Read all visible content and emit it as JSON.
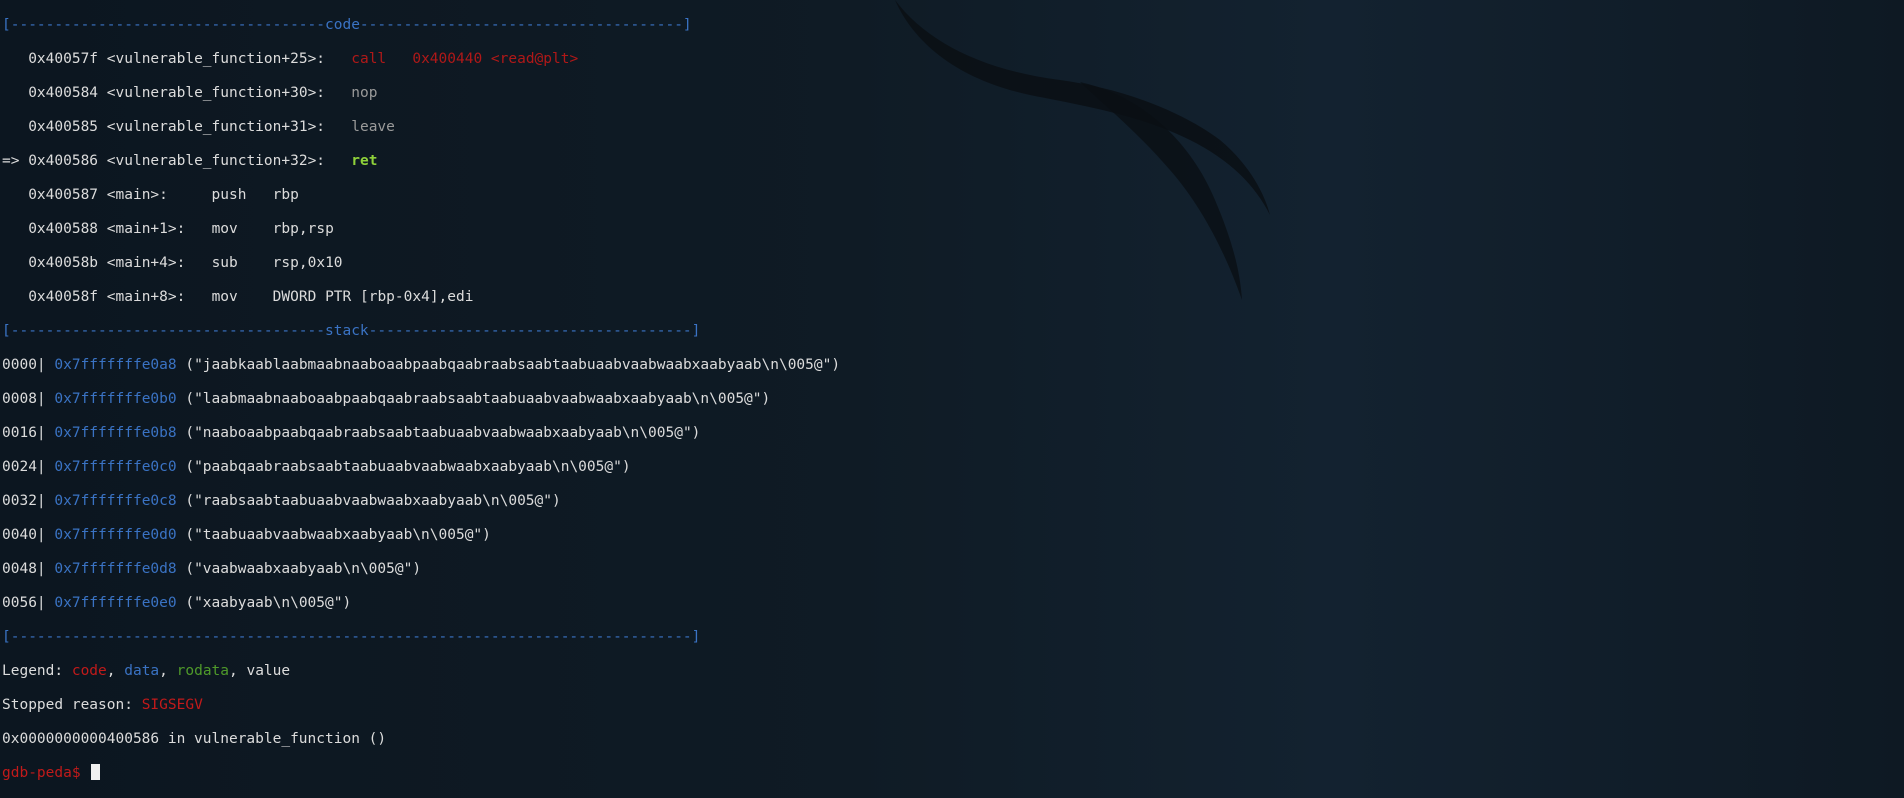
{
  "separators": {
    "code": "[------------------------------------code-------------------------------------]",
    "stack": "[------------------------------------stack-------------------------------------]",
    "end": "[------------------------------------------------------------------------------]"
  },
  "code_lines": [
    {
      "marker": "   ",
      "addr": "0x40057f",
      "sym": "<vulnerable_function+25>:",
      "pad": "   ",
      "op": "call",
      "args": "   0x400440 <read@plt>",
      "kind": "call"
    },
    {
      "marker": "   ",
      "addr": "0x400584",
      "sym": "<vulnerable_function+30>:",
      "pad": "   ",
      "op": "nop",
      "args": "",
      "kind": "dim"
    },
    {
      "marker": "   ",
      "addr": "0x400585",
      "sym": "<vulnerable_function+31>:",
      "pad": "   ",
      "op": "leave",
      "args": "",
      "kind": "dim"
    },
    {
      "marker": "=> ",
      "addr": "0x400586",
      "sym": "<vulnerable_function+32>:",
      "pad": "   ",
      "op": "ret",
      "args": "",
      "kind": "ret"
    },
    {
      "marker": "   ",
      "addr": "0x400587",
      "sym": "<main>:",
      "pad": "     ",
      "op": "push",
      "args": "   rbp",
      "kind": "norm"
    },
    {
      "marker": "   ",
      "addr": "0x400588",
      "sym": "<main+1>:",
      "pad": "   ",
      "op": "mov",
      "args": "    rbp,rsp",
      "kind": "norm"
    },
    {
      "marker": "   ",
      "addr": "0x40058b",
      "sym": "<main+4>:",
      "pad": "   ",
      "op": "sub",
      "args": "    rsp,0x10",
      "kind": "norm"
    },
    {
      "marker": "   ",
      "addr": "0x40058f",
      "sym": "<main+8>:",
      "pad": "   ",
      "op": "mov",
      "args": "    DWORD PTR [rbp-0x4],edi",
      "kind": "norm"
    }
  ],
  "stack_lines": [
    {
      "offset": "0000|",
      "ptr": "0x7fffffffe0a8",
      "value": "(\"jaabkaablaabmaabnaaboaabpaabqaabraabsaabtaabuaabvaabwaabxaabyaab\\n\\005@\")"
    },
    {
      "offset": "0008|",
      "ptr": "0x7fffffffe0b0",
      "value": "(\"laabmaabnaaboaabpaabqaabraabsaabtaabuaabvaabwaabxaabyaab\\n\\005@\")"
    },
    {
      "offset": "0016|",
      "ptr": "0x7fffffffe0b8",
      "value": "(\"naaboaabpaabqaabraabsaabtaabuaabvaabwaabxaabyaab\\n\\005@\")"
    },
    {
      "offset": "0024|",
      "ptr": "0x7fffffffe0c0",
      "value": "(\"paabqaabraabsaabtaabuaabvaabwaabxaabyaab\\n\\005@\")"
    },
    {
      "offset": "0032|",
      "ptr": "0x7fffffffe0c8",
      "value": "(\"raabsaabtaabuaabvaabwaabxaabyaab\\n\\005@\")"
    },
    {
      "offset": "0040|",
      "ptr": "0x7fffffffe0d0",
      "value": "(\"taabuaabvaabwaabxaabyaab\\n\\005@\")"
    },
    {
      "offset": "0048|",
      "ptr": "0x7fffffffe0d8",
      "value": "(\"vaabwaabxaabyaab\\n\\005@\")"
    },
    {
      "offset": "0056|",
      "ptr": "0x7fffffffe0e0",
      "value": "(\"xaabyaab\\n\\005@\")"
    }
  ],
  "legend": {
    "prefix": "Legend: ",
    "code": "code",
    "comma1": ", ",
    "data": "data",
    "comma2": ", ",
    "rodata": "rodata",
    "rest": ", value"
  },
  "stopped": {
    "prefix": "Stopped reason: ",
    "reason": "SIGSEGV"
  },
  "location_line": "0x0000000000400586 in vulnerable_function ()",
  "prompt": "gdb-peda$ ",
  "colors": {
    "code": "#c11a1a",
    "data": "#3a73c4",
    "rodata": "#4f9a2a",
    "ret": "#8fd13a"
  }
}
